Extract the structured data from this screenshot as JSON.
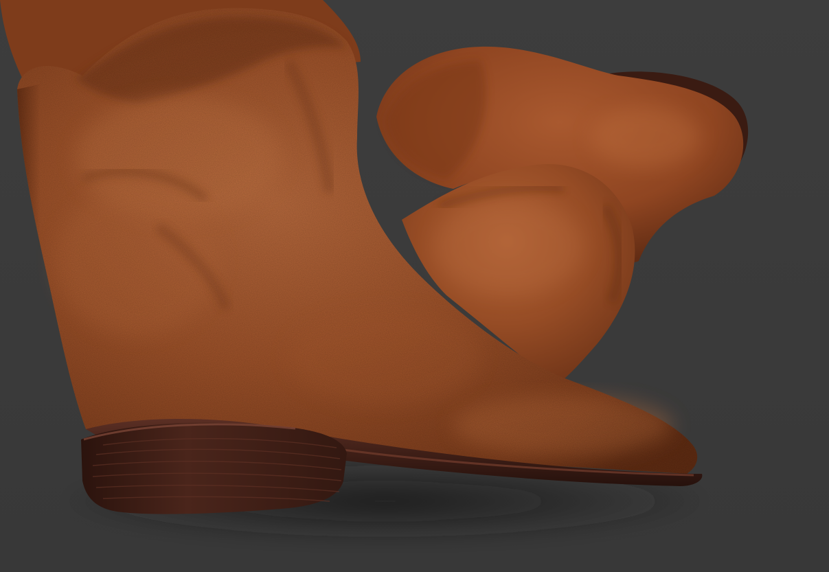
{
  "scene": {
    "subject": "boots-render",
    "colors": {
      "background": "#3b3b3b",
      "leather_base": "#9a4f27",
      "leather_light": "#b5653a",
      "leather_shadow": "#5a2a12",
      "sole": "#3a1c14",
      "sole_light": "#5a2e22"
    }
  }
}
